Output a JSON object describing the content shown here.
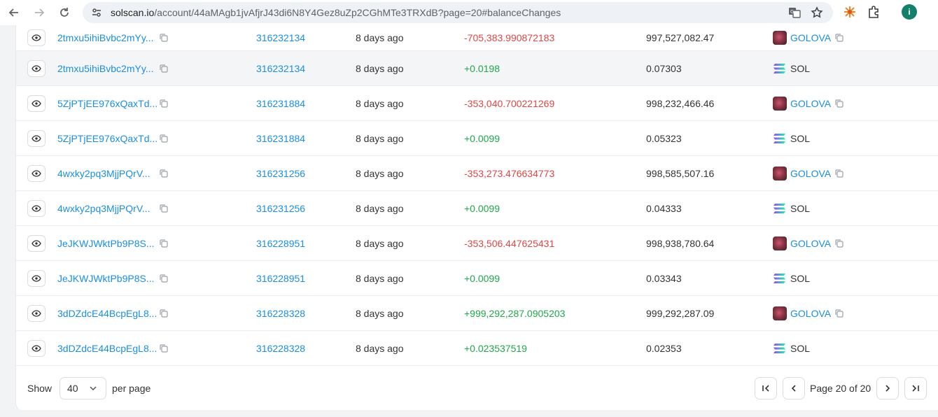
{
  "browser": {
    "url_host": "solscan.io",
    "url_rest": "/account/44aMAgb1jvAfjrJ43di6N8Y4Gez8uZp2CGhMTe3TRXdB?page=20#balanceChanges",
    "avatar_letter": "i"
  },
  "rows": [
    {
      "signature": "2tmxu5ihiBvbc2mYy...",
      "block": "316232134",
      "time": "8 days ago",
      "change": "-705,383.990872183",
      "post_balance": "997,527,082.47",
      "token": "GOLOVA",
      "type": "neg"
    },
    {
      "signature": "2tmxu5ihiBvbc2mYy...",
      "block": "316232134",
      "time": "8 days ago",
      "change": "+0.0198",
      "post_balance": "0.07303",
      "token": "SOL",
      "type": "pos"
    },
    {
      "signature": "5ZjPTjEE976xQaxTd...",
      "block": "316231884",
      "time": "8 days ago",
      "change": "-353,040.700221269",
      "post_balance": "998,232,466.46",
      "token": "GOLOVA",
      "type": "neg"
    },
    {
      "signature": "5ZjPTjEE976xQaxTd...",
      "block": "316231884",
      "time": "8 days ago",
      "change": "+0.0099",
      "post_balance": "0.05323",
      "token": "SOL",
      "type": "pos"
    },
    {
      "signature": "4wxky2pq3MjjPQrV...",
      "block": "316231256",
      "time": "8 days ago",
      "change": "-353,273.476634773",
      "post_balance": "998,585,507.16",
      "token": "GOLOVA",
      "type": "neg"
    },
    {
      "signature": "4wxky2pq3MjjPQrV...",
      "block": "316231256",
      "time": "8 days ago",
      "change": "+0.0099",
      "post_balance": "0.04333",
      "token": "SOL",
      "type": "pos"
    },
    {
      "signature": "JeJKWJWktPb9P8S...",
      "block": "316228951",
      "time": "8 days ago",
      "change": "-353,506.447625431",
      "post_balance": "998,938,780.64",
      "token": "GOLOVA",
      "type": "neg"
    },
    {
      "signature": "JeJKWJWktPb9P8S...",
      "block": "316228951",
      "time": "8 days ago",
      "change": "+0.0099",
      "post_balance": "0.03343",
      "token": "SOL",
      "type": "pos"
    },
    {
      "signature": "3dDZdcE44BcpEgL8...",
      "block": "316228328",
      "time": "8 days ago",
      "change": "+999,292,287.0905203",
      "post_balance": "999,292,287.09",
      "token": "GOLOVA",
      "type": "pos"
    },
    {
      "signature": "3dDZdcE44BcpEgL8...",
      "block": "316228328",
      "time": "8 days ago",
      "change": "+0.023537519",
      "post_balance": "0.02353",
      "token": "SOL",
      "type": "pos"
    }
  ],
  "footer": {
    "show_label": "Show",
    "per_page_value": "40",
    "per_page_label": "per page",
    "page_text": "Page 20 of 20"
  },
  "colors": {
    "link": "#1a8fe3",
    "negative": "#e04646",
    "positive": "#1fa84a"
  }
}
